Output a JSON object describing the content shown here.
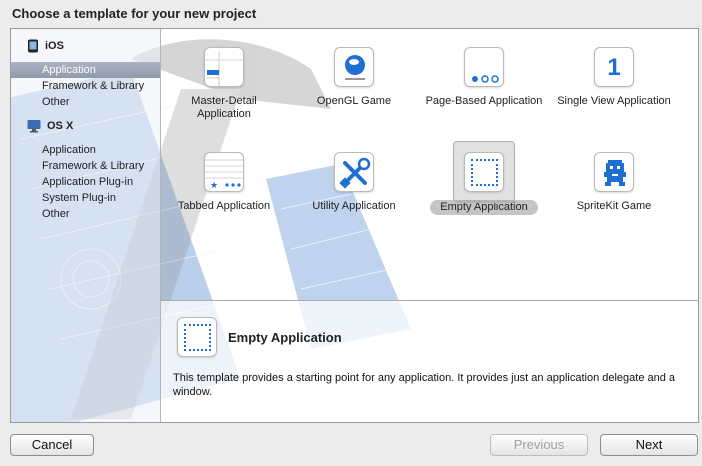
{
  "dialog": {
    "title": "Choose a template for your new project"
  },
  "sidebar": {
    "groups": [
      {
        "label": "iOS",
        "icon": "iphone-icon",
        "items": [
          "Application",
          "Framework & Library",
          "Other"
        ],
        "selected": "Application"
      },
      {
        "label": "OS X",
        "icon": "osx-icon",
        "items": [
          "Application",
          "Framework & Library",
          "Application Plug-in",
          "System Plug-in",
          "Other"
        ]
      }
    ]
  },
  "templates": [
    {
      "label": "Master-Detail Application",
      "icon": "master-detail-icon"
    },
    {
      "label": "OpenGL Game",
      "icon": "opengl-icon"
    },
    {
      "label": "Page-Based Application",
      "icon": "page-based-icon"
    },
    {
      "label": "Single View Application",
      "icon": "single-view-icon",
      "glyph": "1"
    },
    {
      "label": "Tabbed Application",
      "icon": "tabbed-icon"
    },
    {
      "label": "Utility Application",
      "icon": "utility-icon"
    },
    {
      "label": "Empty Application",
      "icon": "empty-application-icon",
      "selected": true
    },
    {
      "label": "SpriteKit Game",
      "icon": "spritekit-icon"
    }
  ],
  "description": {
    "title": "Empty Application",
    "text": "This template provides a starting point for any application. It provides just an application delegate and a window."
  },
  "buttons": {
    "cancel": "Cancel",
    "previous": "Previous",
    "next": "Next"
  },
  "colors": {
    "accent_blue": "#1f6fd2",
    "selection_gray": "#c5c5c5"
  }
}
